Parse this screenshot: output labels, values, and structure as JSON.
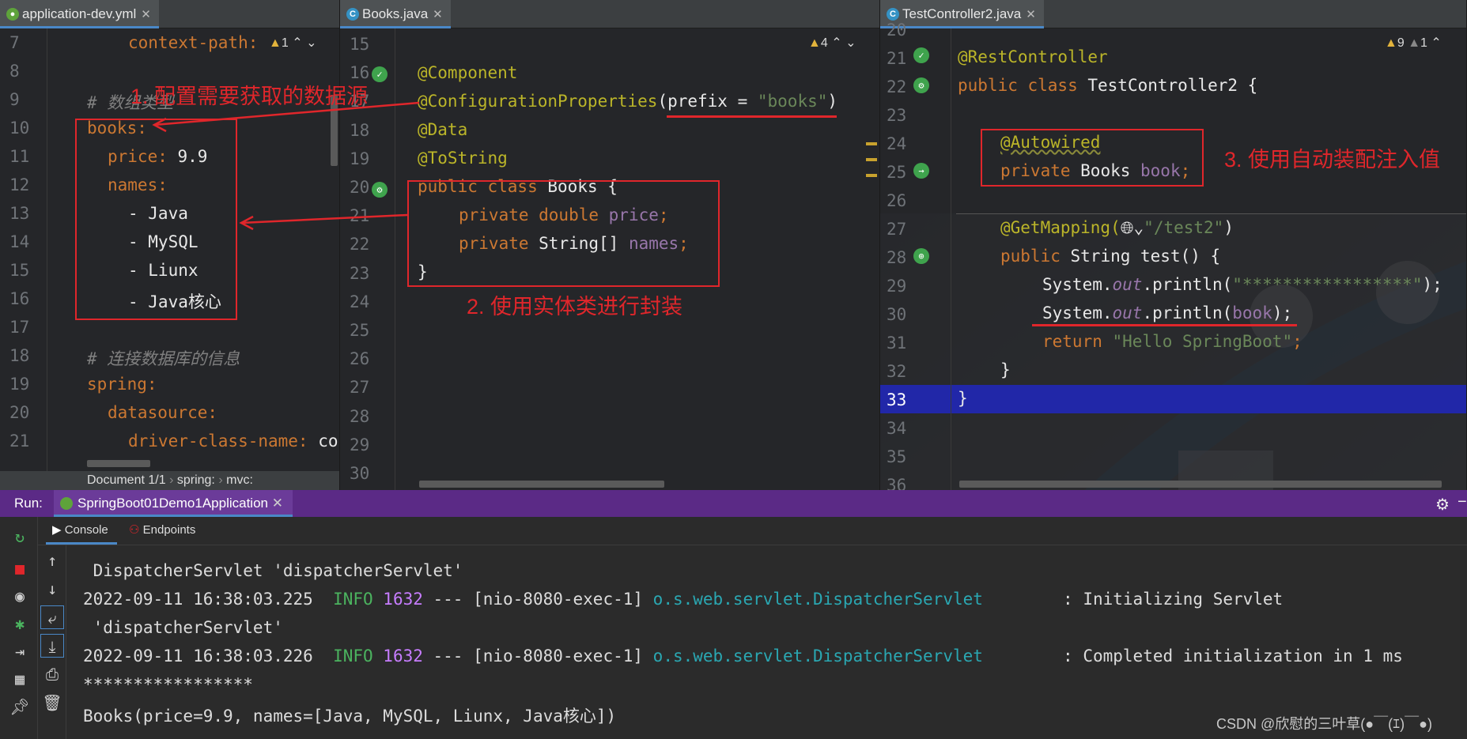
{
  "pane1": {
    "tab": "application-dev.yml",
    "warnings": "1",
    "breadcrumb": [
      "Document 1/1",
      "spring:",
      "mvc:"
    ],
    "lines": [
      {
        "n": "7",
        "text": "context-path:",
        "i": 2
      },
      {
        "n": "8",
        "text": "",
        "i": 0
      },
      {
        "n": "9",
        "text": "# 数组类型",
        "i": 0
      },
      {
        "n": "10",
        "text": "books:",
        "i": 0
      },
      {
        "n": "11",
        "text": "price: 9.9",
        "i": 1
      },
      {
        "n": "12",
        "text": "names:",
        "i": 1
      },
      {
        "n": "13",
        "text": "- Java",
        "i": 2
      },
      {
        "n": "14",
        "text": "- MySQL",
        "i": 2
      },
      {
        "n": "15",
        "text": "- Liunx",
        "i": 2
      },
      {
        "n": "16",
        "text": "- Java核心",
        "i": 2
      },
      {
        "n": "17",
        "text": "",
        "i": 0
      },
      {
        "n": "18",
        "text": "# 连接数据库的信息",
        "i": 0
      },
      {
        "n": "19",
        "text": "spring:",
        "i": 0
      },
      {
        "n": "20",
        "text": "datasource:",
        "i": 1
      },
      {
        "n": "21",
        "text": "driver-class-name: co",
        "i": 2
      }
    ]
  },
  "pane2": {
    "tab": "Books.java",
    "warnings": "4",
    "line_numbers": [
      "15",
      "16",
      "17",
      "18",
      "19",
      "20",
      "21",
      "22",
      "23",
      "24",
      "25",
      "26",
      "27",
      "28",
      "29",
      "30"
    ],
    "code": {
      "l16": "@Component",
      "l17a": "@ConfigurationProperties",
      "l17b": "(prefix = ",
      "l17c": "\"books\"",
      "l17d": ")",
      "l18": "@Data",
      "l19": "@ToString",
      "l20a": "public class ",
      "l20b": "Books {",
      "l21a": "private double ",
      "l21b": "price",
      "l22a": "private ",
      "l22b": "String[] ",
      "l22c": "names",
      "l23": "}"
    }
  },
  "pane3": {
    "tab": "TestController2.java",
    "warnings": "9",
    "weak_warnings": "1",
    "line_numbers": [
      "20",
      "21",
      "22",
      "23",
      "24",
      "25",
      "26",
      "27",
      "28",
      "29",
      "30",
      "31",
      "32",
      "33",
      "34",
      "35",
      "36"
    ],
    "code": {
      "l21": "@RestController",
      "l22a": "public class ",
      "l22b": "TestController2 {",
      "l24": "@Autowired",
      "l25a": "private ",
      "l25b": "Books ",
      "l25c": "book",
      "l27a": "@GetMapping(",
      "l27b": "\"/test2\"",
      "l27c": ")",
      "l28a": "public ",
      "l28b": "String test() {",
      "l29a": "System.",
      "l29b": "out",
      "l29c": ".println(",
      "l29d": "\"*****************\"",
      "l29e": ");",
      "l30a": "System.",
      "l30b": "out",
      "l30c": ".println(",
      "l30d": "book",
      "l30e": ");",
      "l31a": "return ",
      "l31b": "\"Hello SpringBoot\"",
      "l32": "}",
      "l33": "}"
    }
  },
  "annotations": {
    "a1": "1. 配置需要获取的数据源",
    "a2": "2. 使用实体类进行封装",
    "a3": "3. 使用自动装配注入值"
  },
  "run": {
    "label": "Run:",
    "config": "SpringBoot01Demo1Application",
    "tabs": [
      "Console",
      "Endpoints"
    ],
    "log": [
      {
        "plain": " DispatcherServlet 'dispatcherServlet'"
      },
      {
        "ts": "2022-09-11 16:38:03.225",
        "lvl": "INFO",
        "pid": "1632",
        "th": "--- [nio-8080-exec-1]",
        "cls": "o.s.web.servlet.DispatcherServlet",
        "msg": ": Initializing Servlet"
      },
      {
        "plain": " 'dispatcherServlet'"
      },
      {
        "ts": "2022-09-11 16:38:03.226",
        "lvl": "INFO",
        "pid": "1632",
        "th": "--- [nio-8080-exec-1]",
        "cls": "o.s.web.servlet.DispatcherServlet",
        "msg": ": Completed initialization in 1 ms"
      },
      {
        "plain": "*****************"
      },
      {
        "plain": "Books(price=9.9, names=[Java, MySQL, Liunx, Java核心])"
      }
    ]
  },
  "watermark": "CSDN @欣慰的三叶草(●￣(ｴ)￣●)"
}
